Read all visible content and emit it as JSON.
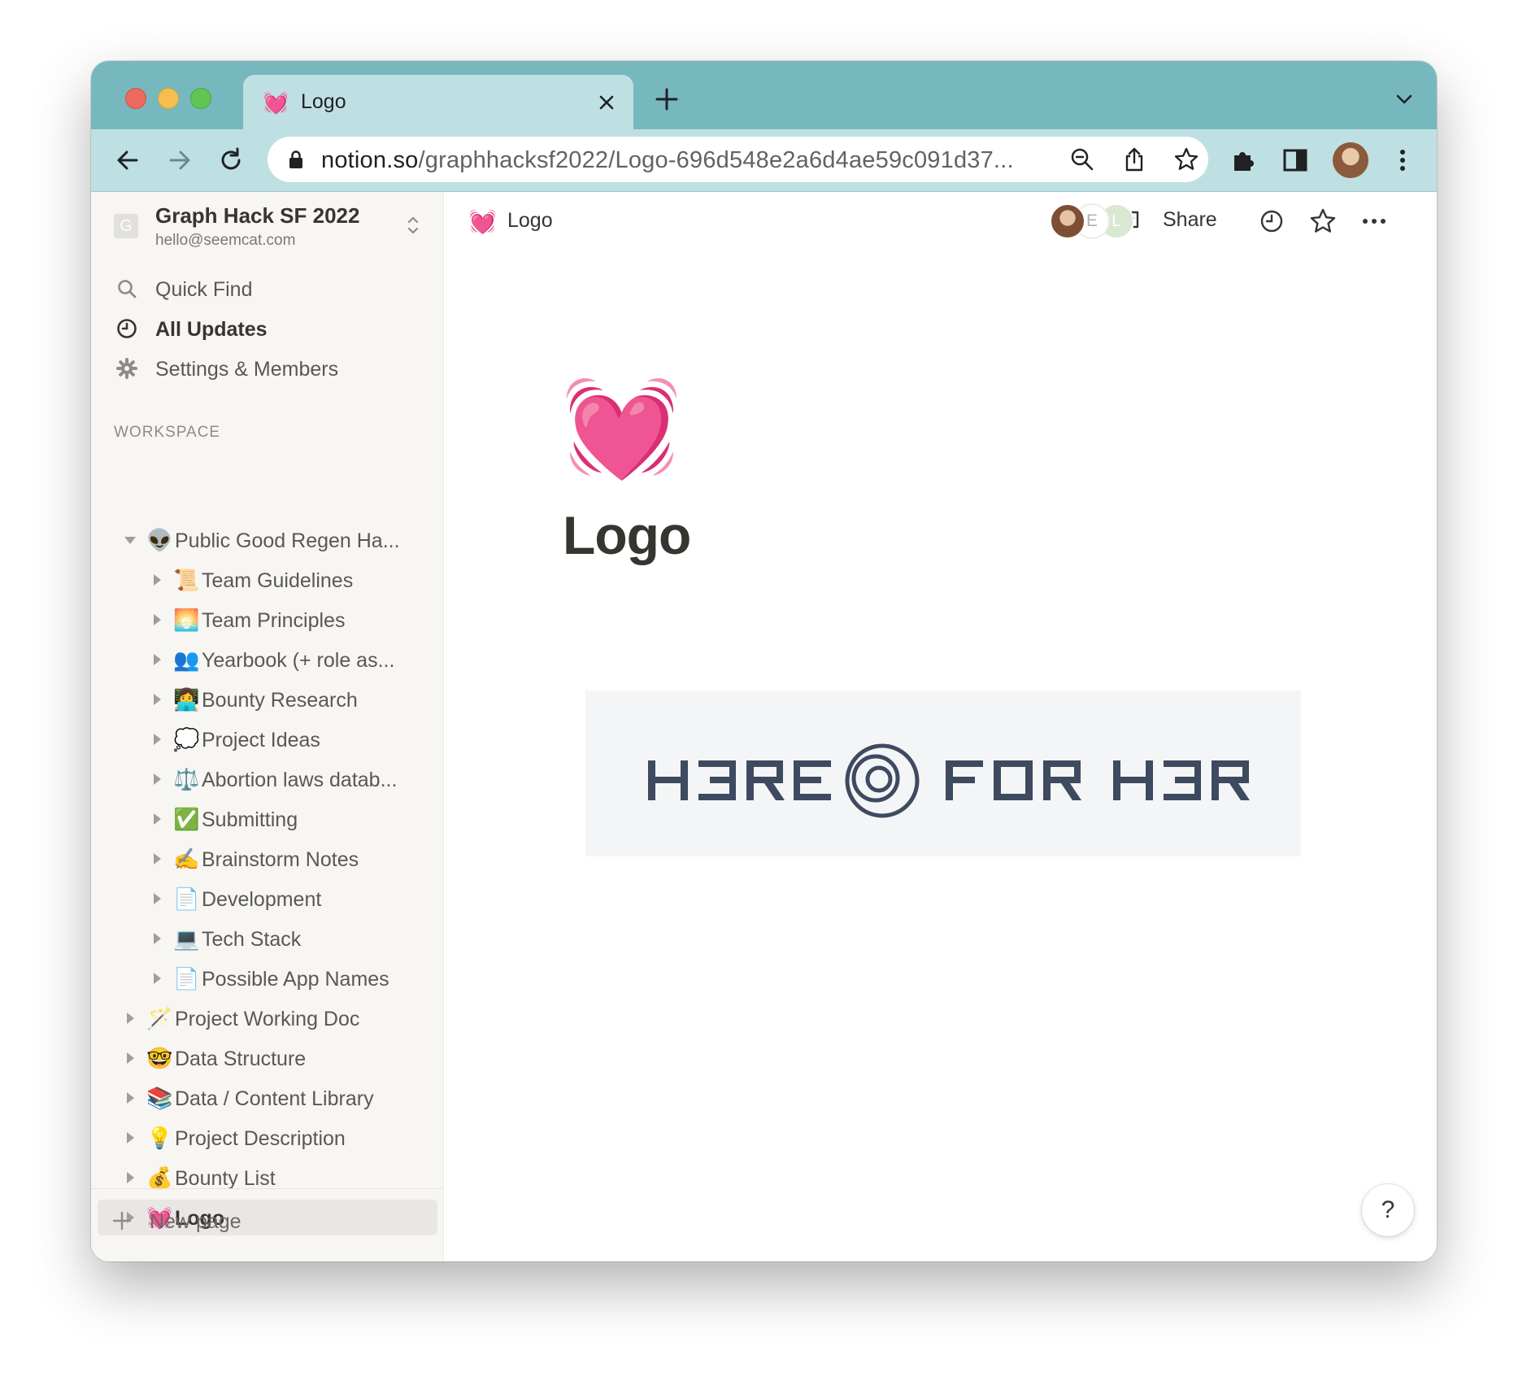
{
  "browser": {
    "tab": {
      "favicon": "💓",
      "title": "Logo"
    },
    "url": {
      "host": "notion.so",
      "path": "/graphhacksf2022/Logo-696d548e2a6d4ae59c091d37..."
    }
  },
  "workspace": {
    "avatar_letter": "G",
    "name": "Graph Hack SF 2022",
    "email": "hello@seemcat.com"
  },
  "nav": [
    {
      "icon": "search-icon",
      "label": "Quick Find"
    },
    {
      "icon": "clock-icon",
      "label": "All Updates"
    },
    {
      "icon": "gear-icon",
      "label": "Settings & Members"
    }
  ],
  "sidebar_section_label": "WORKSPACE",
  "tree": [
    {
      "emoji": "👽",
      "label": "Public Good Regen Ha...",
      "depth": 0,
      "expanded": true
    },
    {
      "emoji": "📜",
      "label": "Team Guidelines",
      "depth": 1
    },
    {
      "emoji": "🌅",
      "label": "Team Principles",
      "depth": 1
    },
    {
      "emoji": "👥",
      "label": "Yearbook (+ role as...",
      "depth": 1
    },
    {
      "emoji": "👩‍💻",
      "label": "Bounty Research",
      "depth": 1
    },
    {
      "emoji": "💭",
      "label": "Project Ideas",
      "depth": 1
    },
    {
      "emoji": "⚖️",
      "label": "Abortion laws datab...",
      "depth": 1
    },
    {
      "emoji": "✅",
      "label": "Submitting",
      "depth": 1
    },
    {
      "emoji": "✍️",
      "label": "Brainstorm Notes",
      "depth": 1
    },
    {
      "emoji": "📄",
      "label": "Development",
      "depth": 1
    },
    {
      "emoji": "💻",
      "label": "Tech Stack",
      "depth": 1
    },
    {
      "emoji": "📄",
      "label": "Possible App Names",
      "depth": 1
    },
    {
      "emoji": "🪄",
      "label": "Project Working Doc",
      "depth": 0
    },
    {
      "emoji": "🤓",
      "label": "Data Structure",
      "depth": 0
    },
    {
      "emoji": "📚",
      "label": "Data / Content Library",
      "depth": 0
    },
    {
      "emoji": "💡",
      "label": "Project Description",
      "depth": 0
    },
    {
      "emoji": "💰",
      "label": "Bounty List",
      "depth": 0
    },
    {
      "emoji": "💓",
      "label": "Logo",
      "depth": 0,
      "active": true
    }
  ],
  "new_page_label": "New page",
  "topbar": {
    "breadcrumb_emoji": "💓",
    "breadcrumb_title": "Logo",
    "collaborators": [
      "",
      "E",
      "L"
    ],
    "share_label": "Share"
  },
  "page": {
    "icon": "💓",
    "title": "Logo",
    "logo_image": {
      "text_left": "HERE",
      "text_right": "FOR H3R"
    }
  },
  "help_label": "?",
  "colors": {
    "tabbar": "#77b8bf",
    "toolbar": "#bfe0e2",
    "sidebar": "#f7f6f3",
    "logo_ink": "#3e4a5f"
  }
}
